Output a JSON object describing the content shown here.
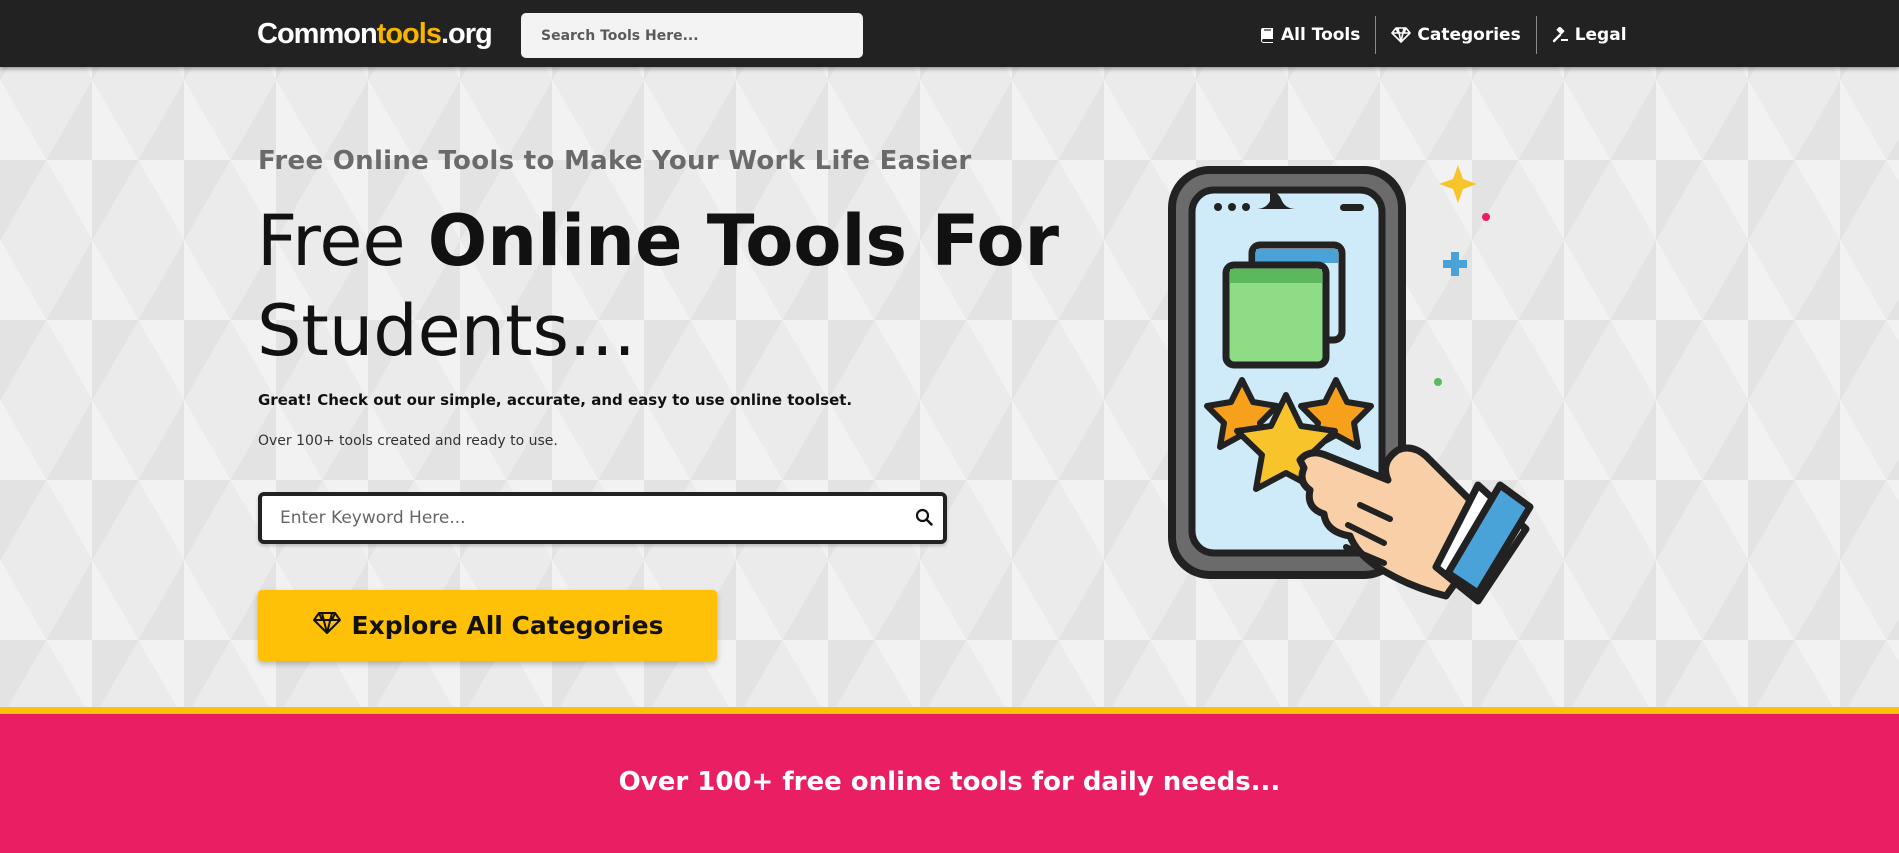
{
  "header": {
    "logo": {
      "part1": "Common",
      "part2": "tools",
      "part3": ".org"
    },
    "search_placeholder": "Search Tools Here...",
    "nav": [
      {
        "label": "All Tools",
        "icon": "book-icon"
      },
      {
        "label": "Categories",
        "icon": "gem-icon"
      },
      {
        "label": "Legal",
        "icon": "gavel-icon"
      }
    ]
  },
  "hero": {
    "eyebrow": "Free Online Tools to Make Your Work Life Easier",
    "headline_light": "Free ",
    "headline_bold": "Online Tools For",
    "headline_light2": "Students...",
    "subline": "Great! Check out our simple, accurate, and easy to use online toolset.",
    "smallline": "Over 100+ tools created and ready to use.",
    "keyword_placeholder": "Enter Keyword Here...",
    "explore_label": "Explore All Categories"
  },
  "band": {
    "text": "Over 100+ free online tools for daily needs..."
  },
  "colors": {
    "accent": "#ffc107",
    "band": "#e91e63",
    "header": "#222222"
  }
}
